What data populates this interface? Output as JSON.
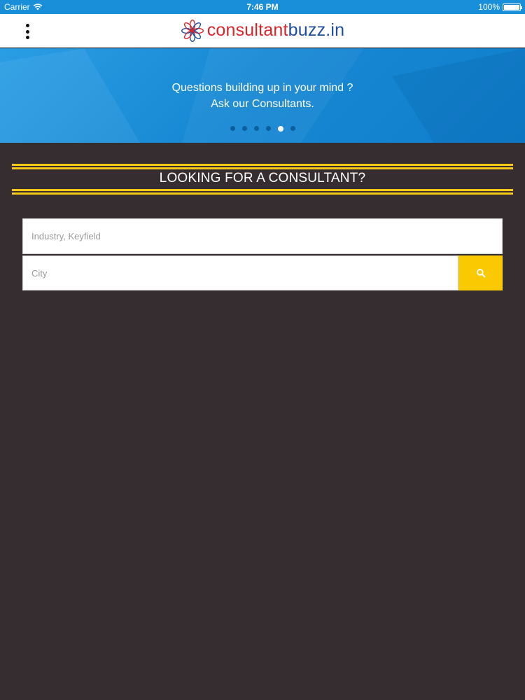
{
  "status_bar": {
    "carrier": "Carrier",
    "time": "7:46 PM",
    "battery": "100%",
    "battery_level": 1.0
  },
  "header": {
    "logo_part1": "consultant",
    "logo_part2": "buzz.in",
    "menu_icon": "more-vertical-icon",
    "colors": {
      "logo_red": "#d7262a",
      "logo_blue": "#1f4f9c"
    }
  },
  "banner": {
    "line1": "Questions building up in your mind ?",
    "line2": "Ask our Consultants.",
    "slide_count": 6,
    "active_slide": 5,
    "color": "#1889d4"
  },
  "section": {
    "title": "LOOKING FOR A CONSULTANT?",
    "accent_color": "#f7c815"
  },
  "search": {
    "keyfield_placeholder": "Industry, Keyfield",
    "keyfield_value": "",
    "city_placeholder": "City",
    "city_value": "",
    "button_icon": "search-icon",
    "button_color": "#fbc901"
  },
  "colors": {
    "background": "#352d2f"
  }
}
